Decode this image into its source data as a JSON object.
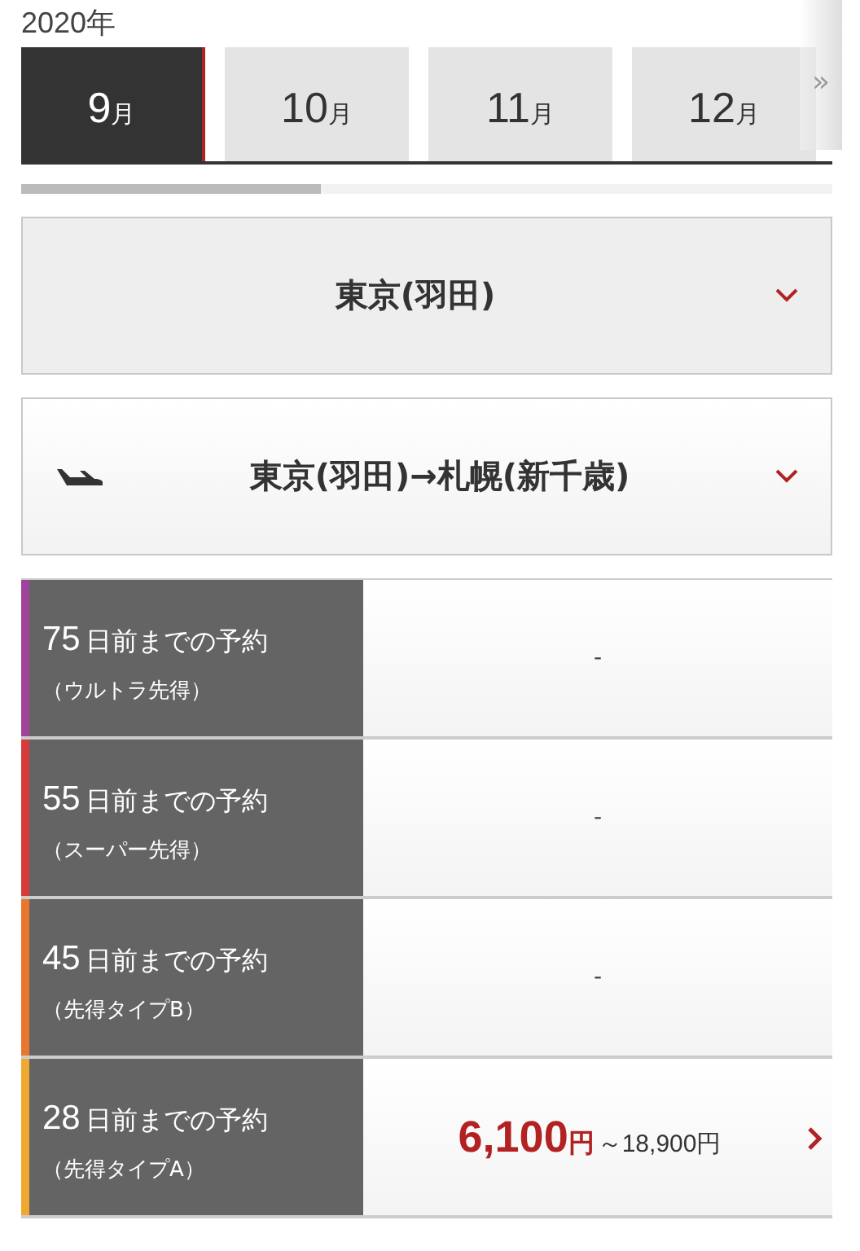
{
  "year": "2020年",
  "months": [
    {
      "number": "9",
      "unit": "月",
      "selected": true
    },
    {
      "number": "10",
      "unit": "月",
      "selected": false
    },
    {
      "number": "11",
      "unit": "月",
      "selected": false
    },
    {
      "number": "12",
      "unit": "月",
      "selected": false
    }
  ],
  "more_hint": "»",
  "departure": {
    "value": "東京(羽田)"
  },
  "route": {
    "value": "東京(羽田)→札幌(新千歳)"
  },
  "fares": [
    {
      "days": "75",
      "label": "日前までの予約",
      "type": "（ウルトラ先得）",
      "color": "#a0439a",
      "kind": "none",
      "price": "-"
    },
    {
      "days": "55",
      "label": "日前までの予約",
      "type": "（スーパー先得）",
      "color": "#d63a3a",
      "kind": "none",
      "price": "-"
    },
    {
      "days": "45",
      "label": "日前までの予約",
      "type": "（先得タイプB）",
      "color": "#e8762c",
      "kind": "none",
      "price": "-"
    },
    {
      "days": "28",
      "label": "日前までの予約",
      "type": "（先得タイプA）",
      "color": "#f0a830",
      "kind": "price",
      "price": "6,100",
      "unit": "円",
      "range": "～18,900円"
    }
  ]
}
